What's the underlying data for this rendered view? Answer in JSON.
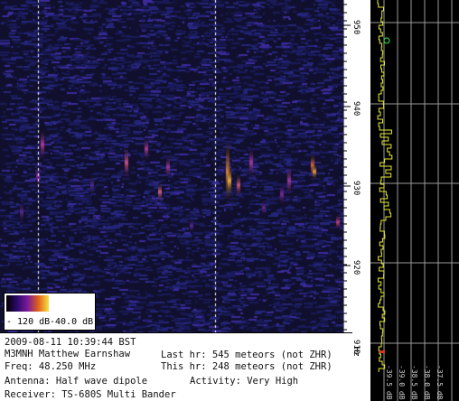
{
  "spectrogram": {
    "background": "#10102e",
    "freq_marks": [
      "950",
      "940",
      "930",
      "920",
      "910"
    ],
    "time_marker_label": "Hz"
  },
  "color_key": {
    "min_label": "- 120 dB",
    "max_label": "-40.0 dB",
    "gradient": [
      "#000000",
      "#2a0a6a",
      "#7a1a9a",
      "#e0601a",
      "#f8e040"
    ]
  },
  "info": {
    "timestamp": "2009-08-11 10:39:44 BST",
    "operator": "M3MNH Matthew Earnshaw",
    "frequency": "Freq: 48.250 MHz",
    "antenna": "Antenna: Half wave dipole",
    "receiver": "Receiver: TS-680S Multi Bander",
    "last_hr": "Last hr: 545 meteors (not ZHR)",
    "this_hr": "This hr: 248 meteors (not ZHR)",
    "activity": "Activity: Very High"
  },
  "level_panel": {
    "labels": [
      "-39.5 dB",
      "-39.0 dB",
      "-38.5 dB",
      "-38.0 dB",
      "-37.5 dB"
    ],
    "trace_color": "#e8e830",
    "bg": "#000000",
    "grid": "#9a9a9a"
  }
}
